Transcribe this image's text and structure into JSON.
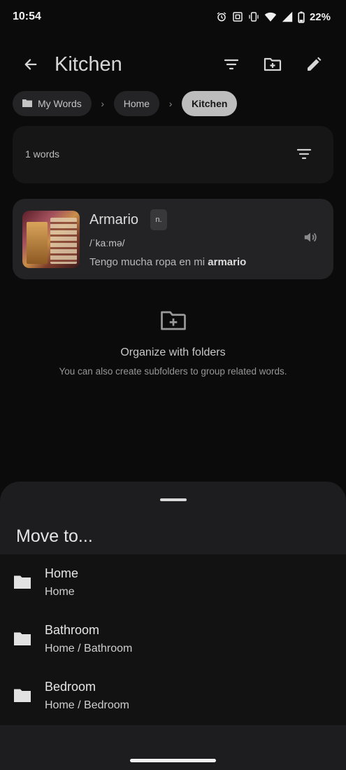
{
  "status_bar": {
    "time": "10:54",
    "battery": "22%"
  },
  "app_bar": {
    "title": "Kitchen"
  },
  "breadcrumb": {
    "items": [
      {
        "label": "My Words"
      },
      {
        "label": "Home"
      },
      {
        "label": "Kitchen"
      }
    ],
    "separator": "›"
  },
  "summary": {
    "count_label": "1 words"
  },
  "word": {
    "title": "Armario",
    "part_of_speech": "n.",
    "pronunciation": "/ˈkaːmə/",
    "example_prefix": "Tengo mucha ropa en mi ",
    "example_highlight": "armario"
  },
  "empty_state": {
    "title": "Organize with folders",
    "subtitle": "You can also create subfolders to group related words."
  },
  "move_sheet": {
    "title": "Move to...",
    "folders": [
      {
        "name": "Home",
        "path": "Home"
      },
      {
        "name": "Bathroom",
        "path": "Home / Bathroom"
      },
      {
        "name": "Bedroom",
        "path": "Home / Bedroom"
      }
    ]
  },
  "colors": {
    "background": "#0b0b0c",
    "sheet": "#1d1d1f",
    "active_crumb": "#bdbdbd",
    "card": "#232325"
  },
  "icons": [
    "alarm-icon",
    "nfc-icon",
    "vibrate-icon",
    "wifi-icon",
    "signal-icon",
    "battery-icon",
    "back-arrow-icon",
    "filter-icon",
    "new-folder-icon",
    "edit-icon",
    "folder-icon",
    "speaker-icon",
    "new-folder-icon"
  ]
}
